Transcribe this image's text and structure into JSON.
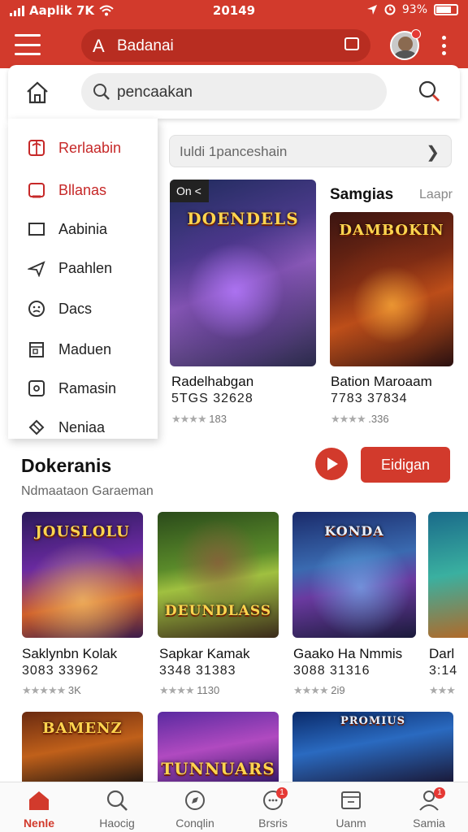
{
  "status_bar": {
    "carrier": "Aaplik 7K",
    "time": "20149",
    "battery": "93%"
  },
  "app_bar": {
    "search_text": "Badanai",
    "search_icon": "A"
  },
  "search": {
    "value": "pencaakan"
  },
  "drawer": {
    "items": [
      {
        "label": "Rerlaabin",
        "icon": "gift-icon",
        "highlight": true
      },
      {
        "label": "Bllanas",
        "icon": "tablet-icon",
        "highlight": true
      },
      {
        "label": "Aabinia",
        "icon": "square-icon",
        "highlight": false
      },
      {
        "label": "Paahlen",
        "icon": "plane-icon",
        "highlight": false
      },
      {
        "label": "Dacs",
        "icon": "face-icon",
        "highlight": false
      },
      {
        "label": "Maduen",
        "icon": "calendar-icon",
        "highlight": false
      },
      {
        "label": "Ramasin",
        "icon": "box-icon",
        "highlight": false
      },
      {
        "label": "Neniaa",
        "icon": "tag-icon",
        "highlight": false
      }
    ]
  },
  "subsearch": {
    "value": "Iuldi 1panceshain"
  },
  "featured": {
    "header": "Samgias",
    "more": "Laapr",
    "cards": [
      {
        "badge": "On <",
        "art_title": "DOENDELS",
        "title": "Radelhabgan",
        "sub": "5TGS 32628",
        "rating": "183"
      },
      {
        "art_title": "DAMBOKIN",
        "title": "Bation Maroaam",
        "sub": "7783 37834",
        "rating": ".336"
      }
    ]
  },
  "section": {
    "title": "Dokeranis",
    "subtitle": "Ndmaataon Garaeman",
    "cta": "Eidigan",
    "cards": [
      {
        "art_title": "JOUSLOLU",
        "title": "Saklynbn Kolak",
        "sub": "3083 33962",
        "rating": "3K"
      },
      {
        "art_title": "DEUNDLASS",
        "title": "Sapkar Kamak",
        "sub": "3348 31383",
        "rating": "1130"
      },
      {
        "art_title": "KONDA",
        "title": "Gaako Ha Nmmis",
        "sub": "3088 31316",
        "rating": "2i9"
      },
      {
        "art_title": "",
        "title": "Darl",
        "sub": "3:14",
        "rating": ""
      }
    ],
    "row2": [
      {
        "art_title": "BAMENZ"
      },
      {
        "art_title": "TUNNUARS"
      },
      {
        "art_title": "PROMIUS"
      }
    ]
  },
  "bottom_nav": [
    {
      "label": "Nenle",
      "icon": "home-icon",
      "active": true,
      "badge": ""
    },
    {
      "label": "Haocig",
      "icon": "search-icon",
      "active": false,
      "badge": ""
    },
    {
      "label": "Conqlin",
      "icon": "compass-icon",
      "active": false,
      "badge": ""
    },
    {
      "label": "Brsris",
      "icon": "chat-icon",
      "active": false,
      "badge": "1"
    },
    {
      "label": "Uanm",
      "icon": "inbox-icon",
      "active": false,
      "badge": ""
    },
    {
      "label": "Samia",
      "icon": "profile-icon",
      "active": false,
      "badge": "1"
    }
  ],
  "colors": {
    "accent": "#d23a2c",
    "badge": "#e53935"
  }
}
